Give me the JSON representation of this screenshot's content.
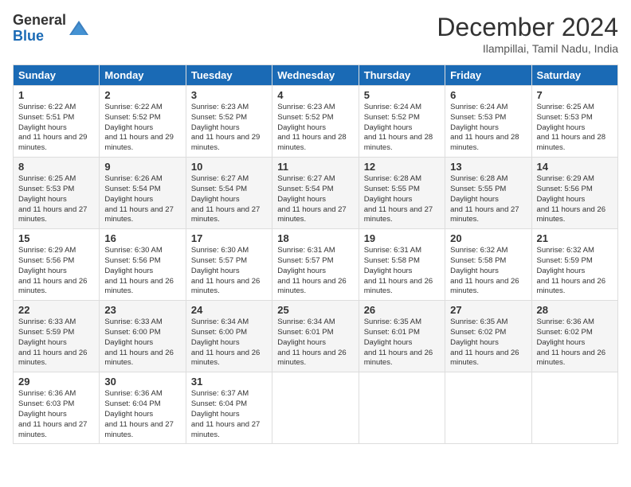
{
  "header": {
    "logo_general": "General",
    "logo_blue": "Blue",
    "title": "December 2024",
    "location": "Ilampillai, Tamil Nadu, India"
  },
  "calendar": {
    "days_of_week": [
      "Sunday",
      "Monday",
      "Tuesday",
      "Wednesday",
      "Thursday",
      "Friday",
      "Saturday"
    ],
    "weeks": [
      [
        null,
        null,
        null,
        null,
        null,
        null,
        null
      ]
    ],
    "cells": [
      {
        "date": 1,
        "col": 0,
        "sunrise": "6:22 AM",
        "sunset": "5:51 PM",
        "daylight": "11 hours and 29 minutes."
      },
      {
        "date": 2,
        "col": 1,
        "sunrise": "6:22 AM",
        "sunset": "5:52 PM",
        "daylight": "11 hours and 29 minutes."
      },
      {
        "date": 3,
        "col": 2,
        "sunrise": "6:23 AM",
        "sunset": "5:52 PM",
        "daylight": "11 hours and 29 minutes."
      },
      {
        "date": 4,
        "col": 3,
        "sunrise": "6:23 AM",
        "sunset": "5:52 PM",
        "daylight": "11 hours and 28 minutes."
      },
      {
        "date": 5,
        "col": 4,
        "sunrise": "6:24 AM",
        "sunset": "5:52 PM",
        "daylight": "11 hours and 28 minutes."
      },
      {
        "date": 6,
        "col": 5,
        "sunrise": "6:24 AM",
        "sunset": "5:53 PM",
        "daylight": "11 hours and 28 minutes."
      },
      {
        "date": 7,
        "col": 6,
        "sunrise": "6:25 AM",
        "sunset": "5:53 PM",
        "daylight": "11 hours and 28 minutes."
      },
      {
        "date": 8,
        "col": 0,
        "sunrise": "6:25 AM",
        "sunset": "5:53 PM",
        "daylight": "11 hours and 27 minutes."
      },
      {
        "date": 9,
        "col": 1,
        "sunrise": "6:26 AM",
        "sunset": "5:54 PM",
        "daylight": "11 hours and 27 minutes."
      },
      {
        "date": 10,
        "col": 2,
        "sunrise": "6:27 AM",
        "sunset": "5:54 PM",
        "daylight": "11 hours and 27 minutes."
      },
      {
        "date": 11,
        "col": 3,
        "sunrise": "6:27 AM",
        "sunset": "5:54 PM",
        "daylight": "11 hours and 27 minutes."
      },
      {
        "date": 12,
        "col": 4,
        "sunrise": "6:28 AM",
        "sunset": "5:55 PM",
        "daylight": "11 hours and 27 minutes."
      },
      {
        "date": 13,
        "col": 5,
        "sunrise": "6:28 AM",
        "sunset": "5:55 PM",
        "daylight": "11 hours and 27 minutes."
      },
      {
        "date": 14,
        "col": 6,
        "sunrise": "6:29 AM",
        "sunset": "5:56 PM",
        "daylight": "11 hours and 26 minutes."
      },
      {
        "date": 15,
        "col": 0,
        "sunrise": "6:29 AM",
        "sunset": "5:56 PM",
        "daylight": "11 hours and 26 minutes."
      },
      {
        "date": 16,
        "col": 1,
        "sunrise": "6:30 AM",
        "sunset": "5:56 PM",
        "daylight": "11 hours and 26 minutes."
      },
      {
        "date": 17,
        "col": 2,
        "sunrise": "6:30 AM",
        "sunset": "5:57 PM",
        "daylight": "11 hours and 26 minutes."
      },
      {
        "date": 18,
        "col": 3,
        "sunrise": "6:31 AM",
        "sunset": "5:57 PM",
        "daylight": "11 hours and 26 minutes."
      },
      {
        "date": 19,
        "col": 4,
        "sunrise": "6:31 AM",
        "sunset": "5:58 PM",
        "daylight": "11 hours and 26 minutes."
      },
      {
        "date": 20,
        "col": 5,
        "sunrise": "6:32 AM",
        "sunset": "5:58 PM",
        "daylight": "11 hours and 26 minutes."
      },
      {
        "date": 21,
        "col": 6,
        "sunrise": "6:32 AM",
        "sunset": "5:59 PM",
        "daylight": "11 hours and 26 minutes."
      },
      {
        "date": 22,
        "col": 0,
        "sunrise": "6:33 AM",
        "sunset": "5:59 PM",
        "daylight": "11 hours and 26 minutes."
      },
      {
        "date": 23,
        "col": 1,
        "sunrise": "6:33 AM",
        "sunset": "6:00 PM",
        "daylight": "11 hours and 26 minutes."
      },
      {
        "date": 24,
        "col": 2,
        "sunrise": "6:34 AM",
        "sunset": "6:00 PM",
        "daylight": "11 hours and 26 minutes."
      },
      {
        "date": 25,
        "col": 3,
        "sunrise": "6:34 AM",
        "sunset": "6:01 PM",
        "daylight": "11 hours and 26 minutes."
      },
      {
        "date": 26,
        "col": 4,
        "sunrise": "6:35 AM",
        "sunset": "6:01 PM",
        "daylight": "11 hours and 26 minutes."
      },
      {
        "date": 27,
        "col": 5,
        "sunrise": "6:35 AM",
        "sunset": "6:02 PM",
        "daylight": "11 hours and 26 minutes."
      },
      {
        "date": 28,
        "col": 6,
        "sunrise": "6:36 AM",
        "sunset": "6:02 PM",
        "daylight": "11 hours and 26 minutes."
      },
      {
        "date": 29,
        "col": 0,
        "sunrise": "6:36 AM",
        "sunset": "6:03 PM",
        "daylight": "11 hours and 27 minutes."
      },
      {
        "date": 30,
        "col": 1,
        "sunrise": "6:36 AM",
        "sunset": "6:04 PM",
        "daylight": "11 hours and 27 minutes."
      },
      {
        "date": 31,
        "col": 2,
        "sunrise": "6:37 AM",
        "sunset": "6:04 PM",
        "daylight": "11 hours and 27 minutes."
      }
    ]
  }
}
